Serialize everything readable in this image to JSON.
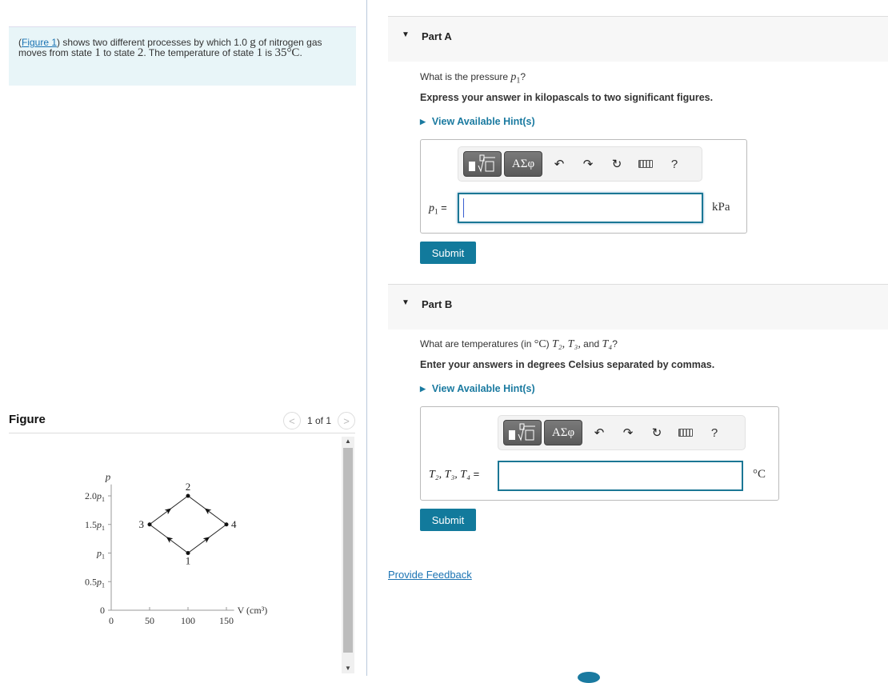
{
  "intro": {
    "figure_link": "Figure 1",
    "text_a": ") shows two different processes by which 1.0 ",
    "unit_g": "g",
    "text_b": " of nitrogen gas moves from state ",
    "state1": "1",
    "text_c": " to state ",
    "state2": "2",
    "text_d": ". The temperature of state ",
    "state1b": "1",
    "text_e": " is ",
    "temp": "35°C",
    "text_f": "."
  },
  "figure": {
    "title": "Figure",
    "pager": "1 of 1",
    "prev_icon": "chevron-left-icon",
    "next_icon": "chevron-right-icon"
  },
  "chart_data": {
    "type": "line",
    "title": "",
    "xlabel": "V (cm³)",
    "ylabel": "p",
    "xlim": [
      0,
      160
    ],
    "ylim": [
      0,
      2.2
    ],
    "x_ticks": [
      0,
      50,
      100,
      150
    ],
    "x_tick_labels": [
      "0",
      "50",
      "100",
      "150"
    ],
    "y_ticks": [
      0,
      0.5,
      1.0,
      1.5,
      2.0
    ],
    "y_tick_labels": [
      "0",
      "0.5p₁",
      "p₁",
      "1.5p₁",
      "2.0p₁"
    ],
    "points": [
      {
        "label": "1",
        "V": 100,
        "p": 1.0
      },
      {
        "label": "2",
        "V": 100,
        "p": 2.0
      },
      {
        "label": "3",
        "V": 50,
        "p": 1.5
      },
      {
        "label": "4",
        "V": 150,
        "p": 1.5
      }
    ],
    "series": [
      {
        "name": "process 1-3-2",
        "x": [
          100,
          50,
          100
        ],
        "y": [
          1.0,
          1.5,
          2.0
        ]
      },
      {
        "name": "process 1-4-2",
        "x": [
          100,
          150,
          100
        ],
        "y": [
          1.0,
          1.5,
          2.0
        ]
      }
    ],
    "grid": false
  },
  "partA": {
    "title": "Part A",
    "question_a": "What is the pressure ",
    "question_var": "p",
    "question_sub": "1",
    "question_b": "?",
    "instruction": "Express your answer in kilopascals to two significant figures.",
    "hint": "View Available Hint(s)",
    "field_label_var": "p",
    "field_label_sub": "1",
    "field_label_eq": " =",
    "value": "",
    "unit": "kPa",
    "submit": "Submit"
  },
  "partB": {
    "title": "Part B",
    "question_a": "What are temperatures (in ",
    "question_unit": "°C",
    "question_b": ") ",
    "question_vars": "T₂, T₃,",
    "question_c": " and ",
    "question_var4": "T₄",
    "question_d": "?",
    "instruction": "Enter your answers in degrees Celsius separated by commas.",
    "hint": "View Available Hint(s)",
    "field_label": "T₂, T₃, T₄",
    "field_label_eq": " =",
    "value": "",
    "unit": "°C",
    "submit": "Submit"
  },
  "toolbar": {
    "templates_label": "√",
    "greek_label": "ΑΣφ",
    "undo": "↶",
    "redo": "↷",
    "reset": "↻",
    "help": "?"
  },
  "feedback": "Provide Feedback"
}
